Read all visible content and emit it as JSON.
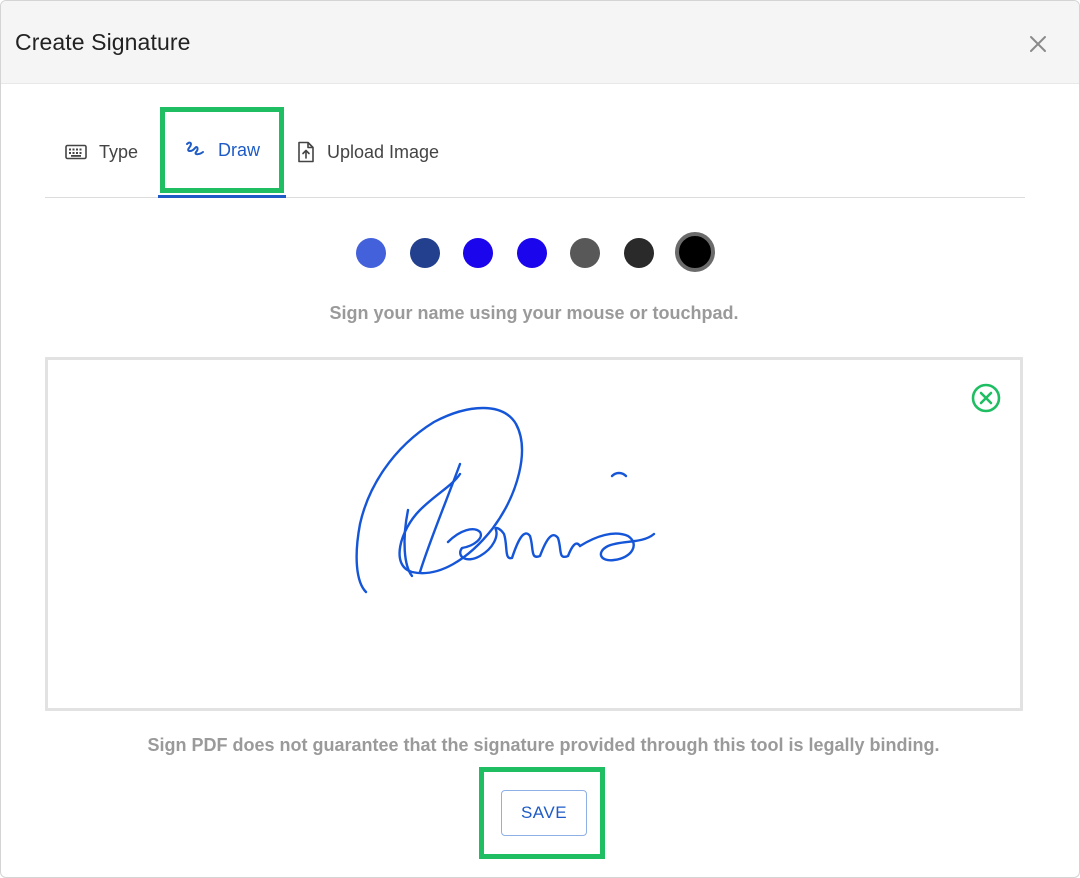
{
  "dialog": {
    "title": "Create Signature",
    "close_icon": "close-icon"
  },
  "tabs": [
    {
      "label": "Type",
      "icon": "keyboard-icon",
      "active": false
    },
    {
      "label": "Draw",
      "icon": "draw-signature-icon",
      "active": true
    },
    {
      "label": "Upload Image",
      "icon": "file-upload-icon",
      "active": false
    }
  ],
  "pen_colors": [
    {
      "color": "#4461dc",
      "selected": false
    },
    {
      "color": "#23408f",
      "selected": false
    },
    {
      "color": "#1a05ec",
      "selected": false
    },
    {
      "color": "#1a05ec",
      "selected": false
    },
    {
      "color": "#585858",
      "selected": false
    },
    {
      "color": "#2a2a2a",
      "selected": false
    },
    {
      "color": "#000000",
      "selected": true
    }
  ],
  "instruction": "Sign your name using your mouse or touchpad.",
  "signature_pad": {
    "stroke_color": "#1555d8",
    "clear_icon": "clear-circle-x-icon",
    "clear_color": "#1fbe63"
  },
  "disclaimer": "Sign PDF does not guarantee that the signature provided through this tool is legally binding.",
  "save_label": "SAVE",
  "highlight_color": "#1fbe63",
  "accent_color": "#1e5bc6"
}
